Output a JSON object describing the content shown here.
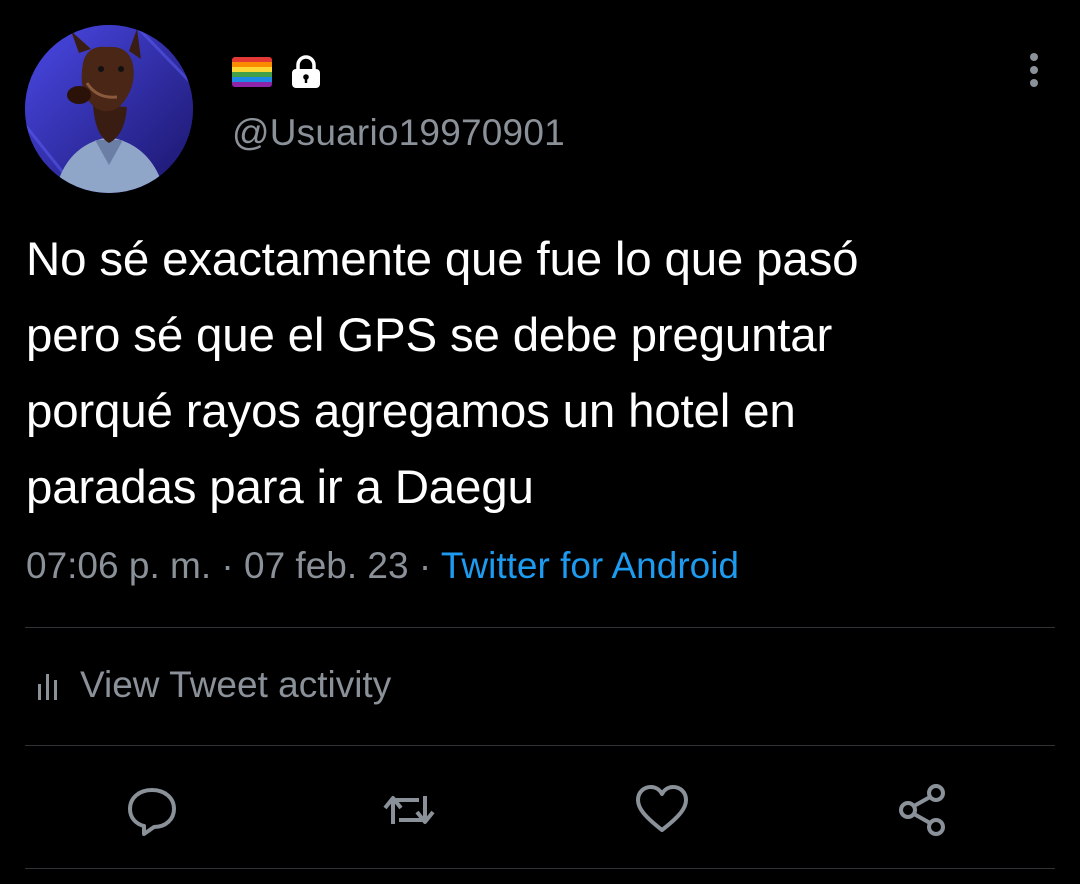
{
  "user": {
    "handle": "@Usuario19970901",
    "avatar_icon": "doberman-avatar",
    "badges": [
      "rainbow-flag-icon",
      "lock-icon"
    ]
  },
  "tweet": {
    "text": "No sé exactamente que fue lo que pasó\npero sé que el GPS se debe preguntar\nporqué rayos agregamos un hotel en\nparadas para ir a Daegu",
    "time": "07:06 p. m.",
    "date": "07 feb. 23",
    "separator": "·",
    "source": "Twitter for Android"
  },
  "activity": {
    "label": "View Tweet activity"
  },
  "actions": [
    "reply-icon",
    "retweet-icon",
    "like-icon",
    "share-icon"
  ],
  "colors": {
    "background": "#000000",
    "text": "#ffffff",
    "muted": "#8b9199",
    "link": "#1d9bf0",
    "divider": "#2f3336"
  }
}
